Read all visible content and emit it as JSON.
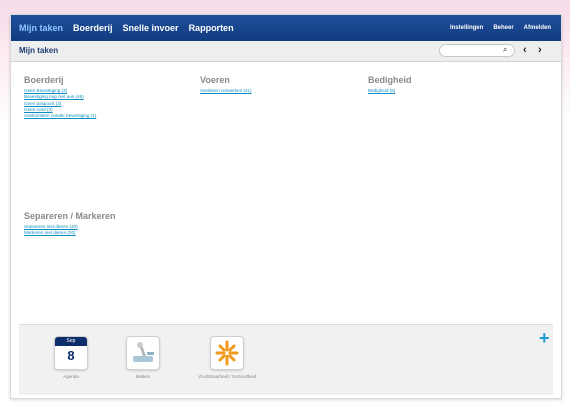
{
  "nav": {
    "items": [
      "Mijn taken",
      "Boerderij",
      "Snelle invoer",
      "Rapporten"
    ],
    "right": [
      "Instellingen",
      "Beheer",
      "Afmelden"
    ]
  },
  "header": {
    "title": "Mijn taken",
    "search_placeholder": ""
  },
  "sections": [
    {
      "title": "Boerderij",
      "links": [
        "Geen Bevestiging (3)",
        "Bevestiging nog niet aan (46)",
        "Geen paspoort (3)",
        "Geen rund (3)",
        "Aankomsten zonder bevestiging (1)"
      ]
    },
    {
      "title": "Voeren",
      "links": [
        "Voederen verwerken (41)"
      ]
    },
    {
      "title": "Bedigheid",
      "links": [
        "Bedigheid (5)"
      ]
    },
    {
      "title": "Separeren / Markeren",
      "links": [
        "Separeren niet dieren (20)",
        "Markeren niet dieren (20)"
      ]
    }
  ],
  "tray": {
    "calendar": {
      "month": "Sep",
      "day": "8",
      "label": "Agenda"
    },
    "tiles": [
      {
        "label": "Melken",
        "icon": "milking-icon"
      },
      {
        "label": "Vruchtbaarheid / Gezondheid",
        "icon": "fertility-icon"
      }
    ],
    "add_label": "+"
  }
}
